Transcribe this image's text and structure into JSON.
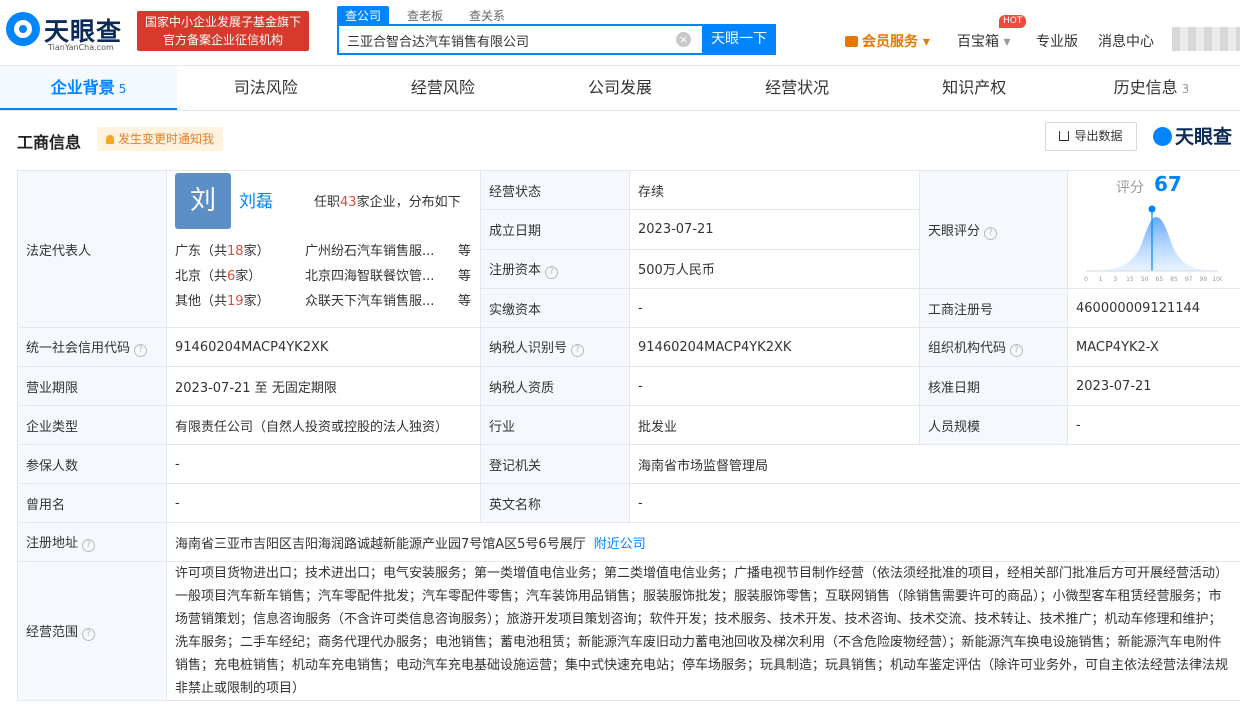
{
  "brand": {
    "name": "天眼查",
    "sub": "TianYanCha.com"
  },
  "gov_badge": {
    "line1": "国家中小企业发展子基金旗下",
    "line2": "官方备案企业征信机构"
  },
  "search": {
    "tabs": [
      "查公司",
      "查老板",
      "查关系"
    ],
    "value": "三亚合智合达汽车销售有限公司",
    "button": "天眼一下"
  },
  "nav": {
    "vip": "会员服务",
    "toolbox": "百宝箱",
    "hot": "HOT",
    "pro": "专业版",
    "messages": "消息中心"
  },
  "tabs": [
    {
      "label": "企业背景",
      "count": "5"
    },
    {
      "label": "司法风险",
      "count": ""
    },
    {
      "label": "经营风险",
      "count": ""
    },
    {
      "label": "公司发展",
      "count": ""
    },
    {
      "label": "经营状况",
      "count": ""
    },
    {
      "label": "知识产权",
      "count": ""
    },
    {
      "label": "历史信息",
      "count": "3"
    }
  ],
  "section": {
    "title": "工商信息",
    "notify": "发生变更时通知我",
    "export": "导出数据",
    "brand": "天眼查"
  },
  "legal": {
    "label": "法定代表人",
    "avatar": "刘",
    "name": "刘磊",
    "summary_pre": "任职",
    "summary_num": "43",
    "summary_post": "家企业，分布如下",
    "regions": [
      {
        "pre": "广东（共",
        "num": "18",
        "post": "家）",
        "company": "广州纷石汽车销售服...",
        "etc": "等"
      },
      {
        "pre": "北京（共",
        "num": "6",
        "post": "家）",
        "company": "北京四海智联餐饮管...",
        "etc": "等"
      },
      {
        "pre": "其他（共",
        "num": "19",
        "post": "家）",
        "company": "众联天下汽车销售服...",
        "etc": "等"
      }
    ]
  },
  "fields": {
    "status_label": "经营状态",
    "status": "存续",
    "founded_label": "成立日期",
    "founded": "2023-07-21",
    "capital_label": "注册资本",
    "capital": "500万人民币",
    "paid_label": "实缴资本",
    "paid": "-",
    "score_label": "天眼评分",
    "score_text": "评分",
    "score": "67",
    "reg_no_label": "工商注册号",
    "reg_no": "460000009121144",
    "credit_label": "统一社会信用代码",
    "credit": "91460204MACP4YK2XK",
    "taxpayer_label": "纳税人识别号",
    "taxpayer": "91460204MACP4YK2XK",
    "org_label": "组织机构代码",
    "org": "MACP4YK2-X",
    "term_label": "营业期限",
    "term": "2023-07-21 至 无固定期限",
    "tax_qual_label": "纳税人资质",
    "tax_qual": "-",
    "approve_label": "核准日期",
    "approve": "2023-07-21",
    "type_label": "企业类型",
    "type": "有限责任公司（自然人投资或控股的法人独资）",
    "industry_label": "行业",
    "industry": "批发业",
    "staff_label": "人员规模",
    "staff": "-",
    "insured_label": "参保人数",
    "insured": "-",
    "authority_label": "登记机关",
    "authority": "海南省市场监督管理局",
    "former_label": "曾用名",
    "former": "-",
    "english_label": "英文名称",
    "english": "-",
    "address_label": "注册地址",
    "address": "海南省三亚市吉阳区吉阳海润路诚越新能源产业园7号馆A区5号6号展厅",
    "nearby": "附近公司",
    "scope_label": "经营范围",
    "scope": "许可项目货物进出口；技术进出口；电气安装服务；第一类增值电信业务；第二类增值电信业务；广播电视节目制作经营（依法须经批准的项目，经相关部门批准后方可开展经营活动）一般项目汽车新车销售；汽车零配件批发；汽车零配件零售；汽车装饰用品销售；服装服饰批发；服装服饰零售；互联网销售（除销售需要许可的商品）；小微型客车租赁经营服务；市场营销策划；信息咨询服务（不含许可类信息咨询服务）；旅游开发项目策划咨询；软件开发；技术服务、技术开发、技术咨询、技术交流、技术转让、技术推广；机动车修理和维护；洗车服务；二手车经纪；商务代理代办服务；电池销售；蓄电池租赁；新能源汽车废旧动力蓄电池回收及梯次利用（不含危险废物经营）；新能源汽车换电设施销售；新能源汽车电附件销售；充电桩销售；机动车充电销售；电动汽车充电基础设施运营；集中式快速充电站；停车场服务；玩具制造；玩具销售；机动车鉴定评估（除许可业务外，可自主依法经营法律法规非禁止或限制的项目）"
  },
  "score_chart": {
    "type": "area",
    "x_ticks": [
      "0",
      "1",
      "3",
      "15",
      "50",
      "65",
      "85",
      "97",
      "99",
      "100"
    ],
    "marker_value": 67
  },
  "colors": {
    "accent": "#0084ff",
    "danger": "#e04b3c",
    "vip": "#e67700"
  }
}
